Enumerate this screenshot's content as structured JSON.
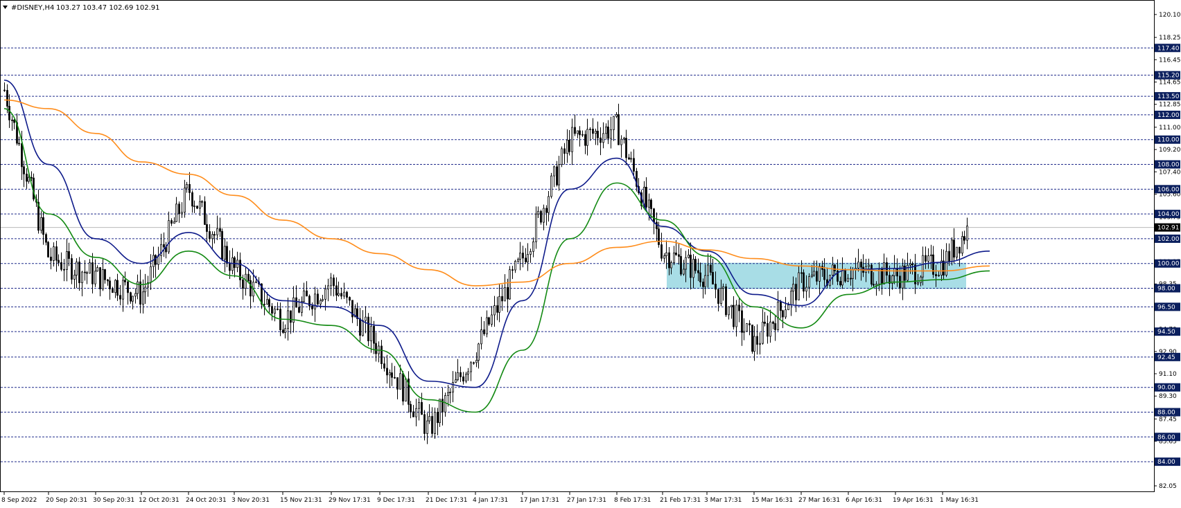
{
  "header": {
    "symbol": "#DISNEY,H4",
    "ohlc": "103.27 103.47 102.69 102.91",
    "menu_icon": "triangle-down-icon"
  },
  "colors": {
    "background": "#ffffff",
    "candles": "#000000",
    "level_lines": "#1f2a8a",
    "ma_fast": "#0d1a8a",
    "ma_mid": "#138a13",
    "ma_slow": "#ff8c1a",
    "zone": "#a8dde6",
    "price_tag_bg": "#0b1f5e",
    "current_tag_bg": "#000000"
  },
  "chart_data": {
    "type": "candlestick",
    "current_price": 102.91,
    "ylim": [
      82.05,
      120.6
    ],
    "y_ticks": [
      "120.10",
      "118.25",
      "116.45",
      "114.65",
      "112.85",
      "111.00",
      "109.20",
      "107.40",
      "105.60",
      "103.75",
      "101.95",
      "100.15",
      "98.35",
      "96.50",
      "94.70",
      "92.90",
      "91.10",
      "89.30",
      "87.45",
      "85.65",
      "83.85",
      "82.05"
    ],
    "levels": [
      "117.40",
      "115.20",
      "113.50",
      "112.00",
      "110.00",
      "108.00",
      "106.00",
      "104.00",
      "102.00",
      "100.00",
      "98.00",
      "96.50",
      "94.50",
      "92.45",
      "90.00",
      "88.00",
      "86.00",
      "84.00"
    ],
    "x_labels": [
      "8 Sep 2022",
      "20 Sep 20:31",
      "30 Sep 20:31",
      "12 Oct 20:31",
      "24 Oct 20:31",
      "3 Nov 20:31",
      "15 Nov 21:31",
      "29 Nov 17:31",
      "9 Dec 17:31",
      "21 Dec 17:31",
      "4 Jan 17:31",
      "17 Jan 17:31",
      "27 Jan 17:31",
      "8 Feb 17:31",
      "21 Feb 17:31",
      "3 Mar 17:31",
      "15 Mar 16:31",
      "27 Mar 16:31",
      "6 Apr 16:31",
      "19 Apr 16:31",
      "1 May 16:31"
    ],
    "zone": {
      "start_label": "21 Feb 17:31",
      "end_label": "1 May 16:31",
      "y_low": 98.0,
      "y_high": 100.0
    },
    "anchors": [
      [
        "8 Sep 2022",
        114.0
      ],
      [
        "20 Sep 20:31",
        100.5
      ],
      [
        "30 Sep 20:31",
        99.0
      ],
      [
        "12 Oct 20:31",
        97.5
      ],
      [
        "24 Oct 20:31",
        106.0
      ],
      [
        "3 Nov 20:31",
        99.5
      ],
      [
        "15 Nov 21:31",
        95.5
      ],
      [
        "29 Nov 17:31",
        98.5
      ],
      [
        "9 Dec 17:31",
        93.0
      ],
      [
        "21 Dec 17:31",
        86.5
      ],
      [
        "4 Jan 17:31",
        93.0
      ],
      [
        "17 Jan 17:31",
        100.5
      ],
      [
        "27 Jan 17:31",
        110.0
      ],
      [
        "8 Feb 17:31",
        111.0
      ],
      [
        "21 Feb 17:31",
        101.0
      ],
      [
        "3 Mar 17:31",
        99.0
      ],
      [
        "15 Mar 16:31",
        93.5
      ],
      [
        "27 Mar 16:31",
        98.5
      ],
      [
        "6 Apr 16:31",
        99.5
      ],
      [
        "19 Apr 16:31",
        99.0
      ],
      [
        "1 May 16:31",
        100.0
      ],
      [
        "last",
        102.91
      ]
    ],
    "series": [
      {
        "role": "fast",
        "values": [
          [
            0,
            114.8
          ],
          [
            1,
            108
          ],
          [
            2,
            102
          ],
          [
            3,
            100
          ],
          [
            4,
            102.5
          ],
          [
            5,
            100
          ],
          [
            6,
            97
          ],
          [
            7,
            96.5
          ],
          [
            8,
            95
          ],
          [
            9,
            90.5
          ],
          [
            10,
            90
          ],
          [
            11,
            97
          ],
          [
            12,
            106
          ],
          [
            13,
            108.5
          ],
          [
            14,
            103
          ],
          [
            15,
            101
          ],
          [
            16,
            97.5
          ],
          [
            17,
            96.6
          ],
          [
            18,
            99.5
          ],
          [
            19,
            99.6
          ],
          [
            20,
            100.1
          ],
          [
            21,
            101
          ]
        ]
      },
      {
        "role": "mid",
        "values": [
          [
            0,
            112.5
          ],
          [
            1,
            104
          ],
          [
            2,
            100.5
          ],
          [
            3,
            98.3
          ],
          [
            4,
            101
          ],
          [
            5,
            99
          ],
          [
            6,
            95.5
          ],
          [
            7,
            95
          ],
          [
            8,
            93
          ],
          [
            9,
            89
          ],
          [
            10,
            88
          ],
          [
            11,
            93
          ],
          [
            12,
            102
          ],
          [
            13,
            106.5
          ],
          [
            14,
            103.5
          ],
          [
            15,
            100.6
          ],
          [
            16,
            96.5
          ],
          [
            17,
            94.8
          ],
          [
            18,
            97.5
          ],
          [
            19,
            98.5
          ],
          [
            20,
            98.7
          ],
          [
            21,
            99.4
          ]
        ]
      },
      {
        "role": "slow",
        "values": [
          [
            0,
            113.2
          ],
          [
            1,
            112.5
          ],
          [
            2,
            110.5
          ],
          [
            3,
            108.2
          ],
          [
            4,
            107.2
          ],
          [
            5,
            105.5
          ],
          [
            6,
            103.5
          ],
          [
            7,
            102
          ],
          [
            8,
            100.8
          ],
          [
            9,
            99.5
          ],
          [
            10,
            98.2
          ],
          [
            11,
            98.5
          ],
          [
            12,
            100
          ],
          [
            13,
            101.3
          ],
          [
            14,
            101.8
          ],
          [
            15,
            101.1
          ],
          [
            16,
            100.4
          ],
          [
            17,
            99.8
          ],
          [
            18,
            99.5
          ],
          [
            19,
            99.4
          ],
          [
            20,
            99.4
          ],
          [
            21,
            99.8
          ]
        ]
      }
    ]
  }
}
